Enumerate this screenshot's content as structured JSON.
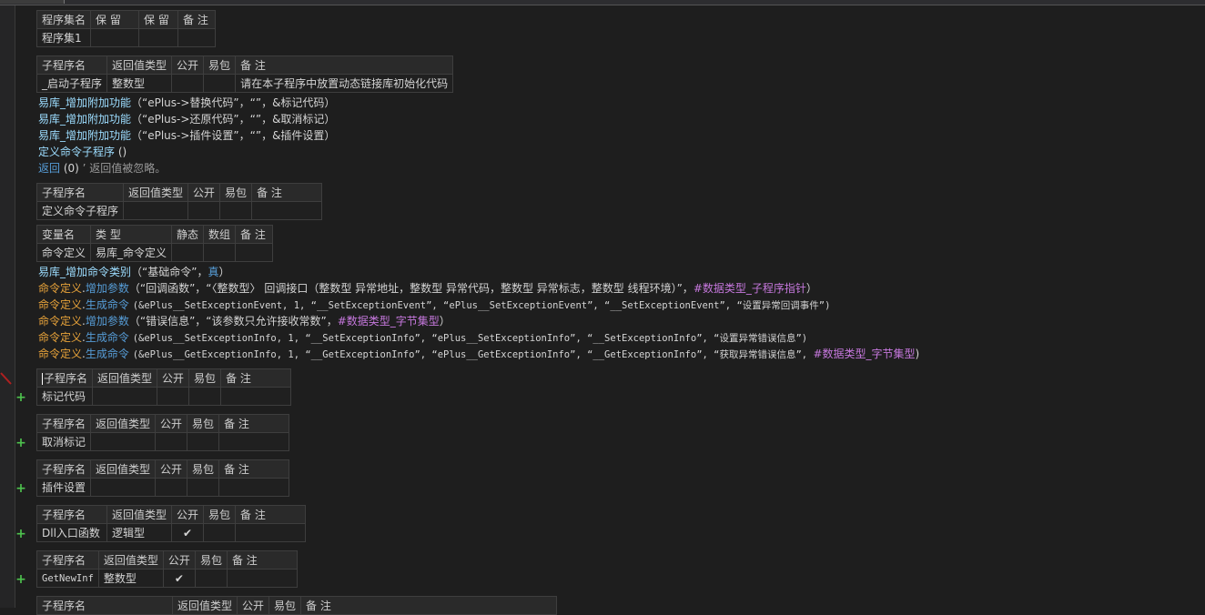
{
  "assembly_table": {
    "headers": [
      "程序集名",
      "保 留",
      "保 留",
      "备 注"
    ],
    "row": [
      "程序集1",
      "",
      "",
      ""
    ]
  },
  "startup_sub": {
    "headers": [
      "子程序名",
      "返回值类型",
      "公开",
      "易包",
      "备 注"
    ],
    "row": [
      "_启动子程序",
      "整数型",
      "",
      "",
      "请在本子程序中放置动态链接库初始化代码"
    ]
  },
  "startup_code": [
    {
      "fn": "易库_增加附加功能",
      "args": "（“ePlus->替换代码”，“”，&标记代码）"
    },
    {
      "fn": "易库_增加附加功能",
      "args": "（“ePlus->还原代码”，“”，&取消标记）"
    },
    {
      "fn": "易库_增加附加功能",
      "args": "（“ePlus->插件设置”，“”，&插件设置）"
    },
    {
      "fn": "定义命令子程序",
      "args": " ()"
    }
  ],
  "return_line": {
    "kw": "返回",
    "args": " (0) ",
    "comment": "’ 返回值被忽略。"
  },
  "define_sub": {
    "headers": [
      "子程序名",
      "返回值类型",
      "公开",
      "易包",
      "备 注"
    ],
    "row": [
      "定义命令子程序",
      "",
      "",
      "",
      ""
    ]
  },
  "var_table": {
    "headers": [
      "变量名",
      "类 型",
      "静态",
      "数组",
      "备 注"
    ],
    "row": [
      "命令定义",
      "易库_命令定义",
      "",
      "",
      ""
    ]
  },
  "define_code": {
    "line1": {
      "fn": "易库_增加命令类别",
      "args": "（“基础命令”，",
      "kw": "真",
      "end": "）"
    },
    "obj": "命令定义",
    "dot": ".",
    "add_param": "增加参数",
    "gen_cmd": "生成命令",
    "line2_args": "（“回调函数”，“〈整数型〉 回调接口（整数型 异常地址，整数型 异常代码，整数型 异常标志，整数型 线程环境）”，",
    "line2_type": "#数据类型_子程序指针",
    "line3_args": "(&ePlus__SetExceptionEvent, 1, “__SetExceptionEvent”, “ePlus__SetExceptionEvent”, “__SetExceptionEvent”, “设置异常回调事件”)",
    "line4_args": "（“错误信息”，“该参数只允许接收常数”，",
    "line4_type": "#数据类型_字节集型",
    "line5_args": "(&ePlus__SetExceptionInfo, 1, “__SetExceptionInfo”, “ePlus__SetExceptionInfo”, “__SetExceptionInfo”, “设置异常错误信息”)",
    "line6_args": "(&ePlus__GetExceptionInfo, 1, “__GetExceptionInfo”, “ePlus__GetExceptionInfo”, “__GetExceptionInfo”, “获取异常错误信息”, ",
    "line6_type": "#数据类型_字节集型",
    "close": ")",
    "close_full": "）"
  },
  "sub_tables": [
    {
      "headers": [
        "子程序名",
        "返回值类型",
        "公开",
        "易包",
        "备 注"
      ],
      "row": [
        "标记代码",
        "",
        "",
        "",
        ""
      ]
    },
    {
      "headers": [
        "子程序名",
        "返回值类型",
        "公开",
        "易包",
        "备 注"
      ],
      "row": [
        "取消标记",
        "",
        "",
        "",
        ""
      ]
    },
    {
      "headers": [
        "子程序名",
        "返回值类型",
        "公开",
        "易包",
        "备 注"
      ],
      "row": [
        "插件设置",
        "",
        "",
        "",
        ""
      ]
    },
    {
      "headers": [
        "子程序名",
        "返回值类型",
        "公开",
        "易包",
        "备 注"
      ],
      "row": [
        "Dll入口函数",
        "逻辑型",
        "✔",
        "",
        ""
      ]
    },
    {
      "headers": [
        "子程序名",
        "返回值类型",
        "公开",
        "易包",
        "备 注"
      ],
      "row": [
        "GetNewInf",
        "整数型",
        "✔",
        "",
        ""
      ]
    },
    {
      "headers": [
        "子程序名",
        "返回值类型",
        "公开",
        "易包",
        "备 注"
      ]
    }
  ],
  "expand_symbol": "+",
  "colors": {
    "background": "#1e1e1e",
    "function": "#9cdcfe",
    "keyword": "#569cd6",
    "object": "#e8a33a",
    "constant": "#c678dd",
    "add_mark": "#4ec24e",
    "check": "#d7c83a"
  }
}
